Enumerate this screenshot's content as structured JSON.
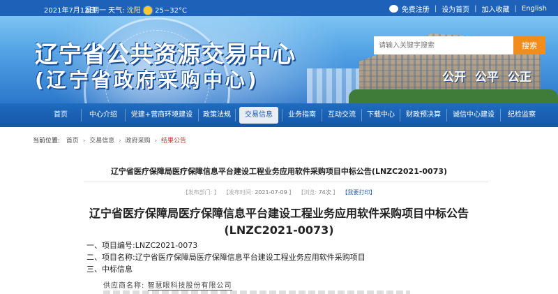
{
  "topbar": {
    "date": "2021年7月12日",
    "weather_label": "星期一  天气:",
    "city": "沈阳",
    "temp": "25~32°C",
    "links": [
      "免费注册",
      "设为首页",
      "加入收藏",
      "English"
    ]
  },
  "banner": {
    "title_line1": "辽宁省公共资源交易中心",
    "title_line2": "(辽宁省政府采购中心)",
    "slogan": [
      "公开",
      "公平",
      "公正"
    ]
  },
  "search": {
    "placeholder": "请输入关键字搜索",
    "button_label": "搜索"
  },
  "nav": {
    "items": [
      "首页",
      "中心介绍",
      "党建+营商环境建设",
      "政策法规",
      "交易信息",
      "业务指南",
      "互动交流",
      "下载中心",
      "财政预决算",
      "诚信中心建设",
      "纪检监察"
    ],
    "active": "交易信息"
  },
  "breadcrumb": {
    "label": "当前位置:",
    "items": [
      "首页",
      "交易信息",
      "政府采购",
      "结果公告"
    ]
  },
  "article": {
    "head_title": "辽宁省医疗保障局医疗保障信息平台建设工程业务应用软件采购项目中标公告(LNZC2021-0073)",
    "meta": {
      "dept_label": "【发布部门:",
      "dept_value": "",
      "time_label": "【发布时间:",
      "time_value": "2021-07-09",
      "views_label": "【浏览:",
      "views_value": "74次",
      "print_label": "【我要打印】"
    },
    "big_title_line1": "辽宁省医疗保障局医疗保障信息平台建设工程业务应用软件采购项目中标公告",
    "big_title_line2": "(LNZC2021-0073)",
    "lines": [
      "一、项目编号:LNZC2021-0073",
      "二、项目名称:辽宁省医疗保障局医疗保障信息平台建设工程业务应用软件采购项目",
      "三、中标信息"
    ],
    "supplier_label": "供应商名称:",
    "supplier_name": "智慧眼科技股份有限公司"
  },
  "colors": {
    "topbar": "#1d62b8",
    "nav": "#1a5fb0",
    "search_button": "#f08d1c",
    "breadcrumb_current": "#d03030",
    "print_link": "#2b65b6"
  }
}
